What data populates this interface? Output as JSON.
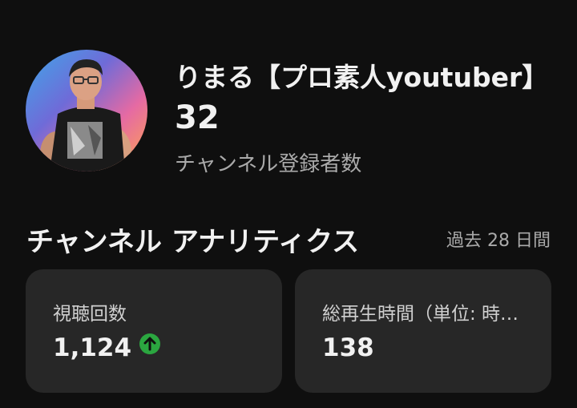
{
  "channel": {
    "name": "りまる【プロ素人youtuber】",
    "subscriber_count": "32",
    "subscriber_label": "チャンネル登録者数"
  },
  "analytics": {
    "title": "チャンネル アナリティクス",
    "period": "過去 28 日間",
    "cards": [
      {
        "label": "視聴回数",
        "value": "1,124",
        "trend": "up",
        "trend_icon": "arrow-up-circle-icon",
        "trend_color": "#2ba640"
      },
      {
        "label": "総再生時間（単位: 時…",
        "value": "138"
      }
    ]
  },
  "colors": {
    "background": "#0f0f0f",
    "card": "#272727",
    "secondary_text": "#aaaaaa"
  }
}
